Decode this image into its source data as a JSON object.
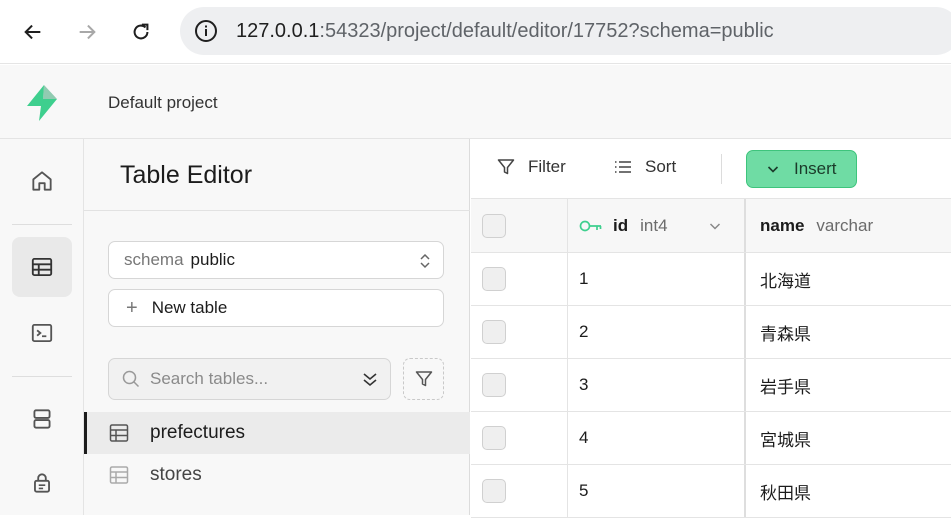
{
  "browser": {
    "url_host": "127.0.0.1",
    "url_rest": ":54323/project/default/editor/17752?schema=public"
  },
  "header": {
    "project_name": "Default project"
  },
  "sidebar_rail": {
    "items": [
      {
        "icon": "home-icon"
      },
      {
        "icon": "table-editor-icon",
        "active": true
      },
      {
        "icon": "sql-editor-icon"
      },
      {
        "icon": "database-icon"
      },
      {
        "icon": "auth-lock-icon"
      }
    ]
  },
  "panel": {
    "title": "Table Editor",
    "schema_label": "schema",
    "schema_value": "public",
    "new_table_label": "New table",
    "search_placeholder": "Search tables...",
    "tables": [
      {
        "name": "prefectures",
        "active": true
      },
      {
        "name": "stores",
        "active": false
      }
    ]
  },
  "toolbar": {
    "filter_label": "Filter",
    "sort_label": "Sort",
    "insert_label": "Insert"
  },
  "grid": {
    "columns": [
      {
        "name": "id",
        "type": "int4"
      },
      {
        "name": "name",
        "type": "varchar"
      }
    ],
    "rows": [
      {
        "id": "1",
        "name": "北海道"
      },
      {
        "id": "2",
        "name": "青森県"
      },
      {
        "id": "3",
        "name": "岩手県"
      },
      {
        "id": "4",
        "name": "宮城県"
      },
      {
        "id": "5",
        "name": "秋田県"
      }
    ]
  },
  "colors": {
    "accent": "#3ecf8e",
    "insert_bg": "#6fdca4"
  }
}
